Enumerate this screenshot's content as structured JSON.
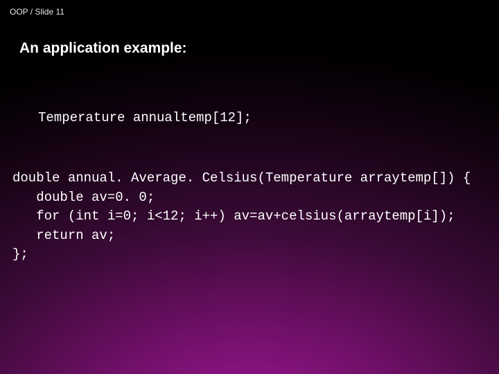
{
  "header": {
    "breadcrumb": "OOP / Slide 11"
  },
  "title": "An application example:",
  "code1": "Temperature annualtemp[12];",
  "code2": "double annual. Average. Celsius(Temperature arraytemp[]) {\n   double av=0. 0;\n   for (int i=0; i<12; i++) av=av+celsius(arraytemp[i]);\n   return av;\n};"
}
